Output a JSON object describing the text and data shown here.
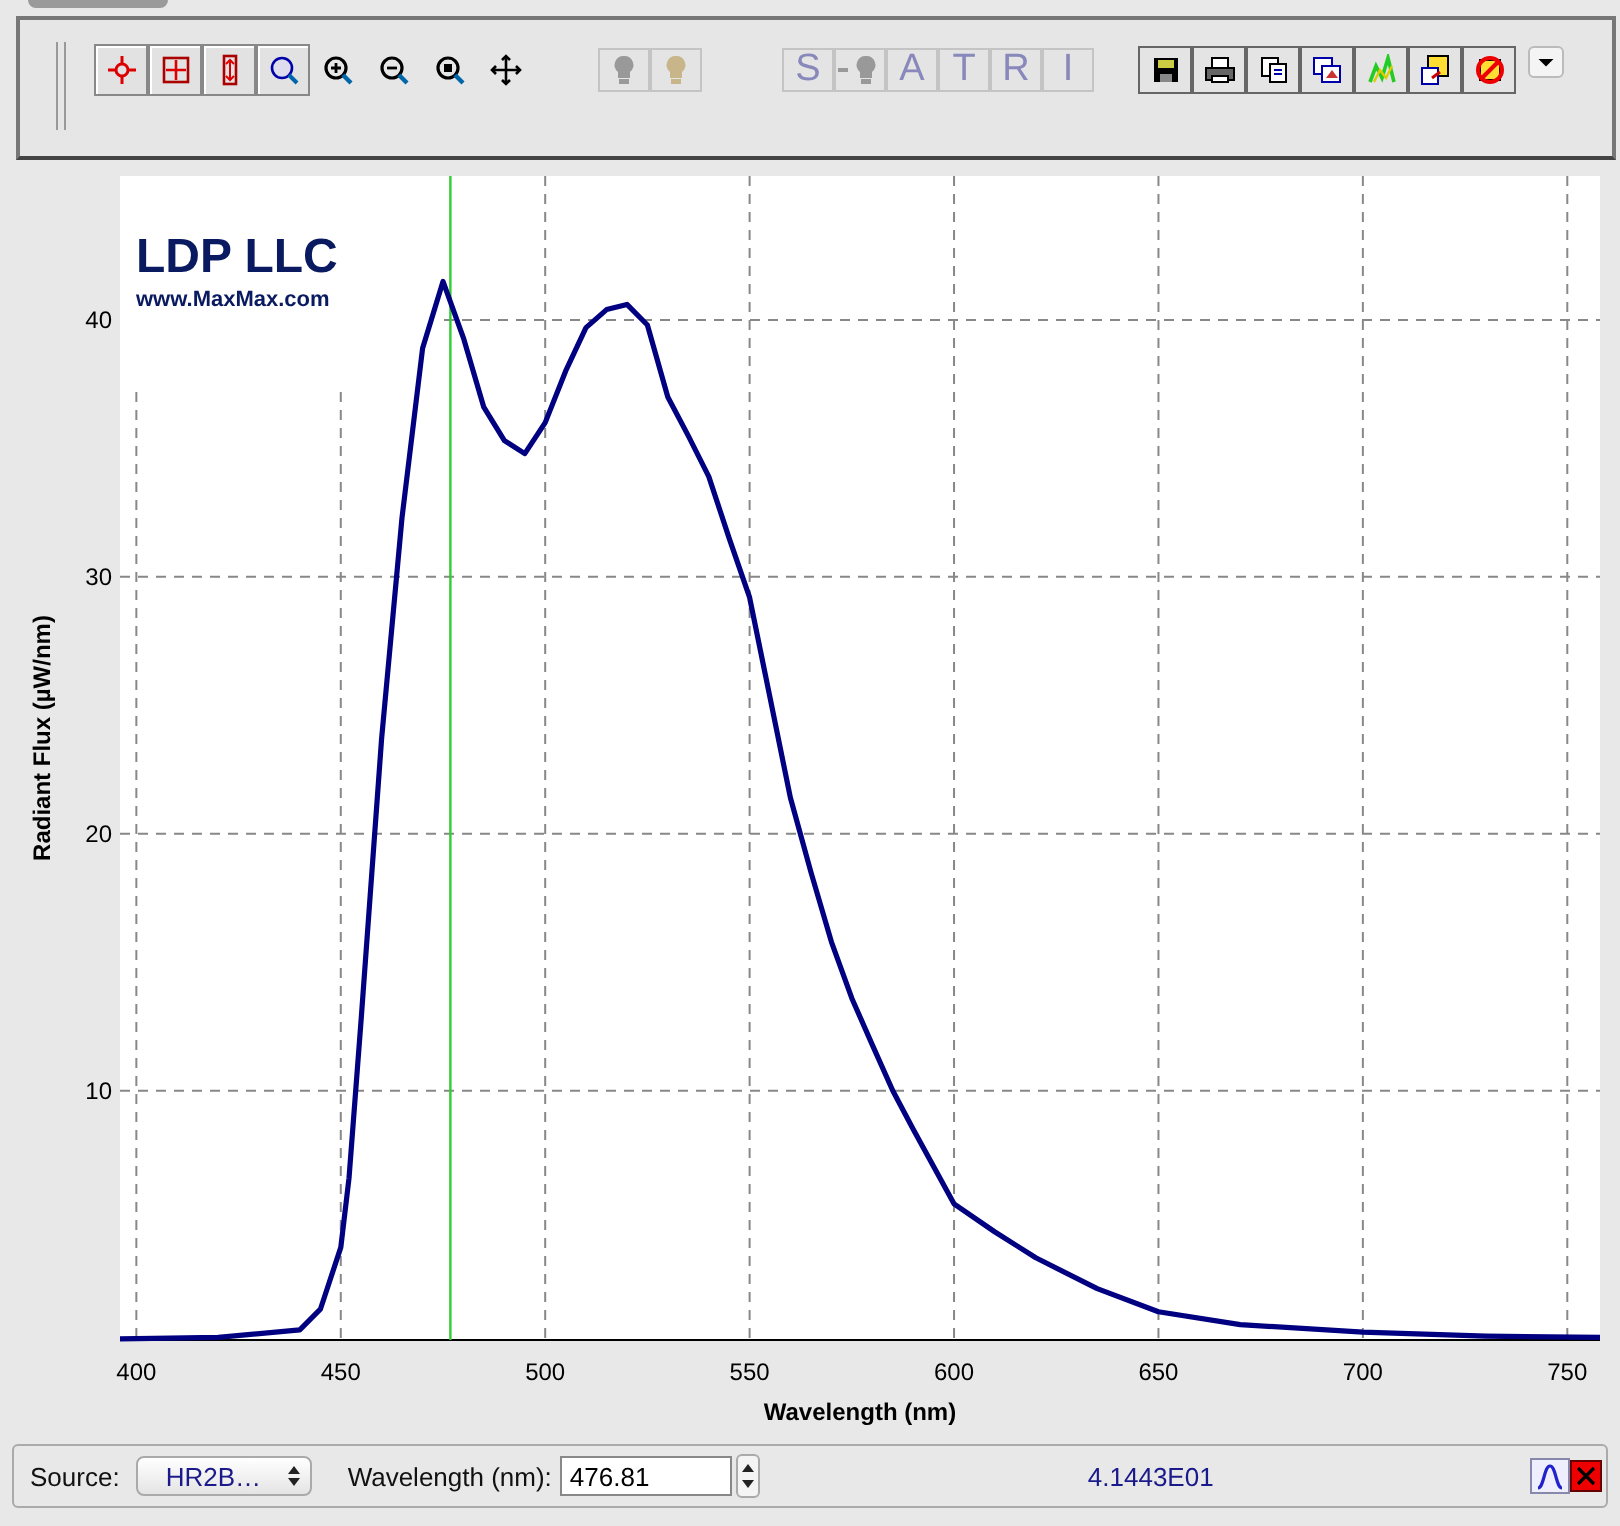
{
  "toolbar": {
    "lamp_buttons": [
      {
        "kind": "bulb",
        "disabled": true
      },
      {
        "kind": "bulb",
        "disabled": true
      }
    ],
    "mode_buttons": [
      {
        "kind": "text",
        "label": "S",
        "disabled": true
      },
      {
        "kind": "bulb",
        "disabled": true
      },
      {
        "kind": "text",
        "label": "A",
        "disabled": true
      },
      {
        "kind": "text",
        "label": "T",
        "disabled": true
      },
      {
        "kind": "text",
        "label": "R",
        "disabled": true
      },
      {
        "kind": "text",
        "label": "I",
        "disabled": true
      }
    ]
  },
  "chart": {
    "logo": {
      "title": "LDP LLC",
      "url": "www.MaxMax.com"
    },
    "chart_data": {
      "type": "line",
      "xlabel": "Wavelength (nm)",
      "ylabel": "Radiant Flux (µW/nm)",
      "xlim": [
        396,
        758
      ],
      "ylim": [
        0.3,
        45.6
      ],
      "xticks": [
        400,
        450,
        500,
        550,
        600,
        650,
        700,
        750
      ],
      "yticks": [
        10,
        20,
        30,
        40
      ],
      "x": [
        396,
        420,
        440,
        445,
        450,
        452,
        455,
        460,
        465,
        470,
        475,
        480,
        485,
        490,
        495,
        500,
        505,
        510,
        515,
        520,
        525,
        530,
        535,
        540,
        545,
        550,
        555,
        560,
        565,
        570,
        575,
        580,
        585,
        590,
        600,
        610,
        620,
        635,
        650,
        670,
        700,
        730,
        758
      ],
      "series": [
        {
          "color": "#000080",
          "values": [
            0.35,
            0.4,
            0.7,
            1.5,
            3.9,
            6.6,
            12.8,
            23.7,
            32.3,
            38.9,
            41.5,
            39.3,
            36.6,
            35.3,
            34.8,
            36,
            38,
            39.7,
            40.4,
            40.6,
            39.8,
            37,
            35.5,
            33.9,
            31.5,
            29.2,
            25.3,
            21.4,
            18.5,
            15.8,
            13.6,
            11.8,
            10,
            8.5,
            5.6,
            4.5,
            3.5,
            2.3,
            1.4,
            0.9,
            0.6,
            0.45,
            0.4
          ]
        }
      ],
      "grid": true,
      "ref_lines": [
        {
          "axis": "x",
          "value": 476.81,
          "color": "#33cc33"
        }
      ]
    }
  },
  "status_bar": {
    "source_label": "Source:",
    "source_value": "HR2B…",
    "wavelength_label": "Wavelength (nm):",
    "wavelength_value": "476.81",
    "reading": "4.1443E01"
  }
}
